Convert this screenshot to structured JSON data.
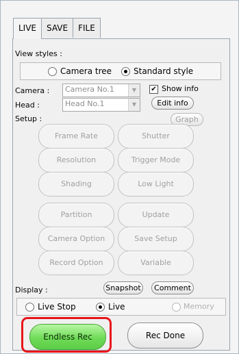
{
  "tabs": [
    "LIVE",
    "SAVE",
    "FILE"
  ],
  "view_styles": {
    "label": "View styles :",
    "options": [
      {
        "label": "Camera tree",
        "selected": false
      },
      {
        "label": "Standard style",
        "selected": true
      }
    ]
  },
  "camera": {
    "label": "Camera :",
    "value": "Camera No.1"
  },
  "head": {
    "label": "Head :",
    "value": "Head No.1"
  },
  "show_info": {
    "label": "Show info",
    "checked": true
  },
  "edit_info": "Edit info",
  "graph": "Graph",
  "setup": {
    "label": "Setup :",
    "buttons": [
      [
        "Frame Rate",
        "Shutter"
      ],
      [
        "Resolution",
        "Trigger Mode"
      ],
      [
        "Shading",
        "Low Light"
      ],
      [
        "Partition",
        "Update"
      ],
      [
        "Camera Option",
        "Save Setup"
      ],
      [
        "Record Option",
        "Variable"
      ]
    ]
  },
  "display": {
    "label": "Display :",
    "snapshot": "Snapshot",
    "comment": "Comment",
    "options": [
      {
        "label": "Live Stop",
        "selected": false,
        "enabled": true
      },
      {
        "label": "Live",
        "selected": true,
        "enabled": true
      },
      {
        "label": "Memory",
        "selected": false,
        "enabled": false
      }
    ]
  },
  "endless_rec": "Endless Rec",
  "rec_done": "Rec Done",
  "colors": {
    "endless_rec": "#6fdc58",
    "highlight": "#e8141a"
  }
}
